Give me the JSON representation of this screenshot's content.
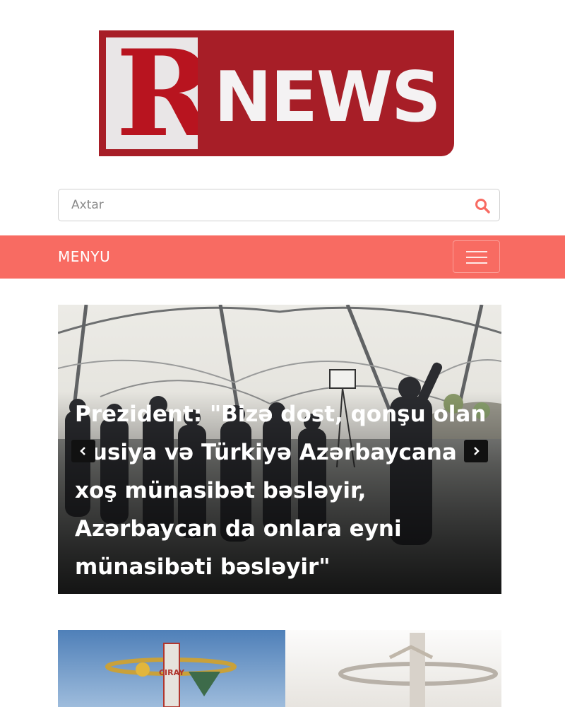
{
  "logo": {
    "letter": "R",
    "word": "NEWS"
  },
  "search": {
    "placeholder": "Axtar"
  },
  "menu": {
    "label": "MENYU"
  },
  "slider": {
    "headline": "Prezident: \"Bizə dost, qonşu olan Rusiya və Türkiyə Azərbaycana xoş münasibət bəsləyir, Azərbaycan da onlara eyni münasibəti bəsləyir\""
  },
  "thumb": {
    "sign_text": "CIRAY"
  },
  "colors": {
    "brand_red": "#a71e27",
    "menu_bar": "#f86b62",
    "search_icon": "#f86b62"
  },
  "icons": [
    "search-icon",
    "hamburger-icon",
    "chevron-left-icon",
    "chevron-right-icon"
  ]
}
